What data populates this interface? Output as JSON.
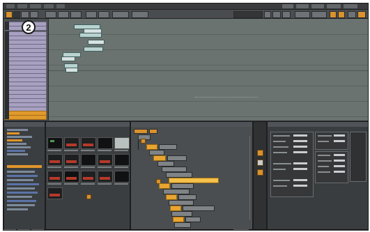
{
  "app": {
    "callout_number": "2"
  },
  "menubar": {
    "menu_count_left": 5,
    "menu_count_right": 5
  },
  "toolbar": {
    "buttons": [
      "orange",
      "dark",
      "gray",
      "gray",
      "gray",
      "gray",
      "gray",
      "gray",
      "gray",
      "gray",
      "gray",
      "gray",
      "gray",
      "gray",
      "gray",
      "gray",
      "gray",
      "orange"
    ]
  },
  "timeline": {
    "track_count": 26,
    "track_accent_color": "#e09a2c",
    "track_color": "#a8a0c0",
    "clip_color": "#b9d2d0"
  },
  "panels": {
    "tree": {
      "icon": "folder-tree-icon"
    },
    "thumbnails": {
      "icon": "thumbnail-grid-icon"
    },
    "nodes": {
      "icon": "node-tree-icon"
    },
    "properties": {
      "icon": "properties-icon"
    }
  },
  "colors": {
    "background": "#2d2f30",
    "timeline_bg": "#6a7370",
    "accent_orange": "#e8a532",
    "highlight": "#f3c04a"
  }
}
